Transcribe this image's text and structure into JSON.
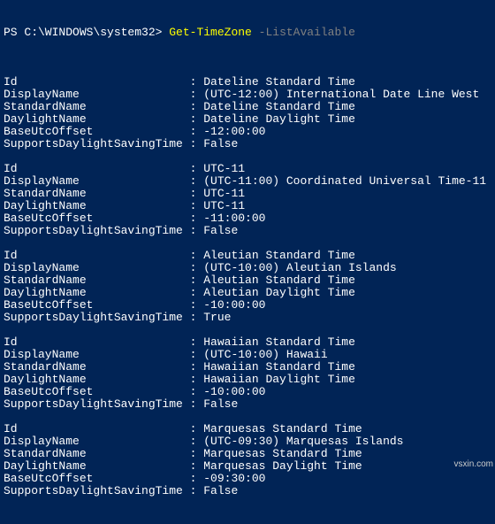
{
  "prompt": {
    "prefix": "PS C:\\WINDOWS\\system32> ",
    "cmdlet": "Get-TimeZone",
    "param": " -ListAvailable"
  },
  "fields": [
    "Id",
    "DisplayName",
    "StandardName",
    "DaylightName",
    "BaseUtcOffset",
    "SupportsDaylightSavingTime"
  ],
  "records": [
    {
      "Id": "Dateline Standard Time",
      "DisplayName": "(UTC-12:00) International Date Line West",
      "StandardName": "Dateline Standard Time",
      "DaylightName": "Dateline Daylight Time",
      "BaseUtcOffset": "-12:00:00",
      "SupportsDaylightSavingTime": "False"
    },
    {
      "Id": "UTC-11",
      "DisplayName": "(UTC-11:00) Coordinated Universal Time-11",
      "StandardName": "UTC-11",
      "DaylightName": "UTC-11",
      "BaseUtcOffset": "-11:00:00",
      "SupportsDaylightSavingTime": "False"
    },
    {
      "Id": "Aleutian Standard Time",
      "DisplayName": "(UTC-10:00) Aleutian Islands",
      "StandardName": "Aleutian Standard Time",
      "DaylightName": "Aleutian Daylight Time",
      "BaseUtcOffset": "-10:00:00",
      "SupportsDaylightSavingTime": "True"
    },
    {
      "Id": "Hawaiian Standard Time",
      "DisplayName": "(UTC-10:00) Hawaii",
      "StandardName": "Hawaiian Standard Time",
      "DaylightName": "Hawaiian Daylight Time",
      "BaseUtcOffset": "-10:00:00",
      "SupportsDaylightSavingTime": "False"
    },
    {
      "Id": "Marquesas Standard Time",
      "DisplayName": "(UTC-09:30) Marquesas Islands",
      "StandardName": "Marquesas Standard Time",
      "DaylightName": "Marquesas Daylight Time",
      "BaseUtcOffset": "-09:30:00",
      "SupportsDaylightSavingTime": "False"
    }
  ],
  "label_width": 27,
  "watermark": "vsxin.com"
}
